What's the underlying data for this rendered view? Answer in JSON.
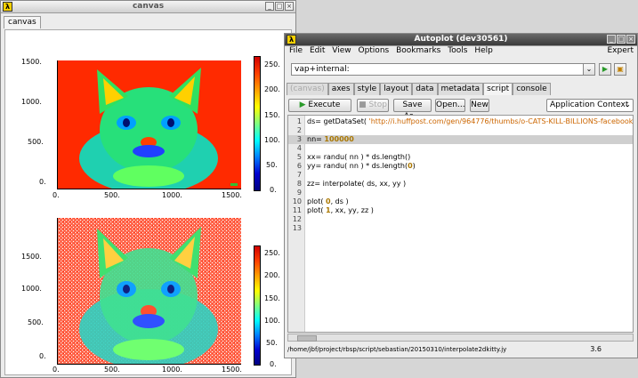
{
  "canvas_window": {
    "title": "canvas",
    "tab": "canvas",
    "plots": [
      {
        "x_ticks": [
          "0.",
          "500.",
          "1000.",
          "1500."
        ],
        "y_ticks": [
          "1500.",
          "1000.",
          "500.",
          "0."
        ],
        "colorbar_ticks": [
          "250.",
          "200.",
          "150.",
          "100.",
          "50.",
          "0."
        ]
      },
      {
        "x_ticks": [
          "0.",
          "500.",
          "1000.",
          "1500."
        ],
        "y_ticks": [
          "1500.",
          "1000.",
          "500.",
          "0."
        ],
        "colorbar_ticks": [
          "250.",
          "200.",
          "150.",
          "100.",
          "50.",
          "0."
        ]
      }
    ]
  },
  "autoplot_window": {
    "title": "Autoplot (dev30561)",
    "menu": [
      "File",
      "Edit",
      "View",
      "Options",
      "Bookmarks",
      "Tools",
      "Help"
    ],
    "menu_right": "Expert",
    "uri_value": "vap+internal:",
    "tabs": [
      "(canvas)",
      "axes",
      "style",
      "layout",
      "data",
      "metadata",
      "script",
      "console"
    ],
    "selected_tab": "script",
    "buttons": {
      "execute": "Execute",
      "stop": "Stop",
      "save_as": "Save As...",
      "open": "Open...",
      "new": "New"
    },
    "context_select": "Application Context",
    "code_lines": [
      {
        "n": "1",
        "parts": [
          [
            "t",
            "ds= getDataSet( "
          ],
          [
            "s",
            "'http://i.huffpost.com/gen/964776/thumbs/o-CATS-KILL-BILLIONS-facebook.jpg?channel=greyscale'"
          ],
          [
            "t",
            " )"
          ]
        ]
      },
      {
        "n": "2",
        "parts": []
      },
      {
        "n": "3",
        "parts": [
          [
            "t",
            "nn= "
          ],
          [
            "n",
            "100000"
          ]
        ]
      },
      {
        "n": "4",
        "parts": []
      },
      {
        "n": "5",
        "parts": [
          [
            "t",
            "xx= randu( nn ) * ds.length()"
          ]
        ]
      },
      {
        "n": "6",
        "parts": [
          [
            "t",
            "yy= randu( nn ) * ds.length("
          ],
          [
            "n",
            "0"
          ],
          [
            "t",
            ")"
          ]
        ]
      },
      {
        "n": "7",
        "parts": []
      },
      {
        "n": "8",
        "parts": [
          [
            "t",
            "zz= interpolate( ds, xx, yy )"
          ]
        ]
      },
      {
        "n": "9",
        "parts": []
      },
      {
        "n": "10",
        "parts": [
          [
            "t",
            "plot( "
          ],
          [
            "n",
            "0"
          ],
          [
            "t",
            ", ds )"
          ]
        ]
      },
      {
        "n": "11",
        "parts": [
          [
            "t",
            "plot( "
          ],
          [
            "n",
            "1"
          ],
          [
            "t",
            ", xx, yy, zz )"
          ]
        ]
      },
      {
        "n": "12",
        "parts": []
      },
      {
        "n": "13",
        "parts": []
      }
    ],
    "status_path": "/home/jbf/project/rbsp/script/sebastian/20150310/interpolate2dkitty.jy",
    "status_pos": "3.6"
  },
  "colors": {
    "title_active": "#4a4a4a",
    "code_string": "#cc6600",
    "code_number": "#aa7700"
  }
}
